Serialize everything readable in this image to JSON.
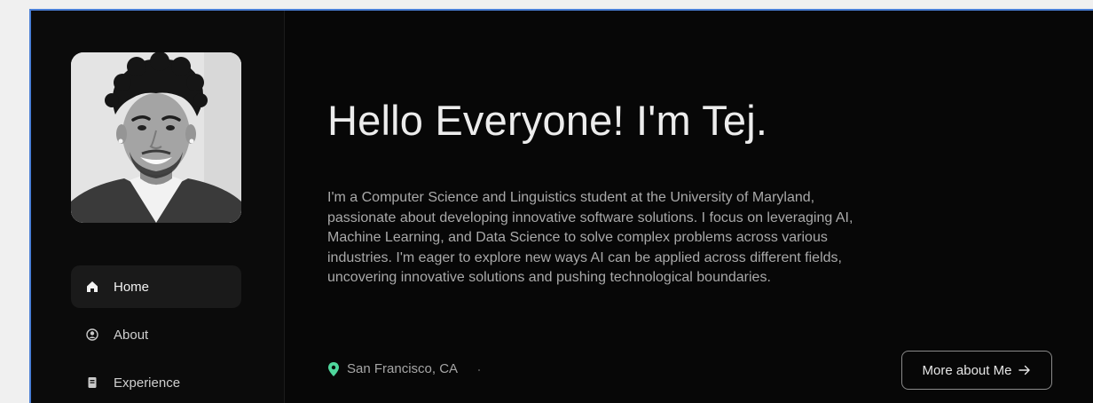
{
  "profile": {
    "photo_alt": "Portrait of Tej"
  },
  "nav": {
    "items": [
      {
        "label": "Home",
        "icon": "home-icon",
        "active": true
      },
      {
        "label": "About",
        "icon": "user-circle-icon",
        "active": false
      },
      {
        "label": "Experience",
        "icon": "document-icon",
        "active": false
      }
    ]
  },
  "hero": {
    "title": "Hello Everyone! I'm Tej.",
    "bio": "I'm a Computer Science and Linguistics student at the University of Maryland, passionate about developing innovative software solutions. I focus on leveraging AI, Machine Learning, and Data Science to solve complex problems across various industries. I'm eager to explore new ways AI can be applied across different fields, uncovering innovative solutions and pushing technological boundaries.",
    "location": "San Francisco, CA",
    "more_button": "More about Me"
  },
  "colors": {
    "background": "#070707",
    "sidebar": "#0b0b0b",
    "active_nav": "#1a1a1a",
    "location_pin": "#4fd69c",
    "frame_border": "#4a7fd6"
  }
}
